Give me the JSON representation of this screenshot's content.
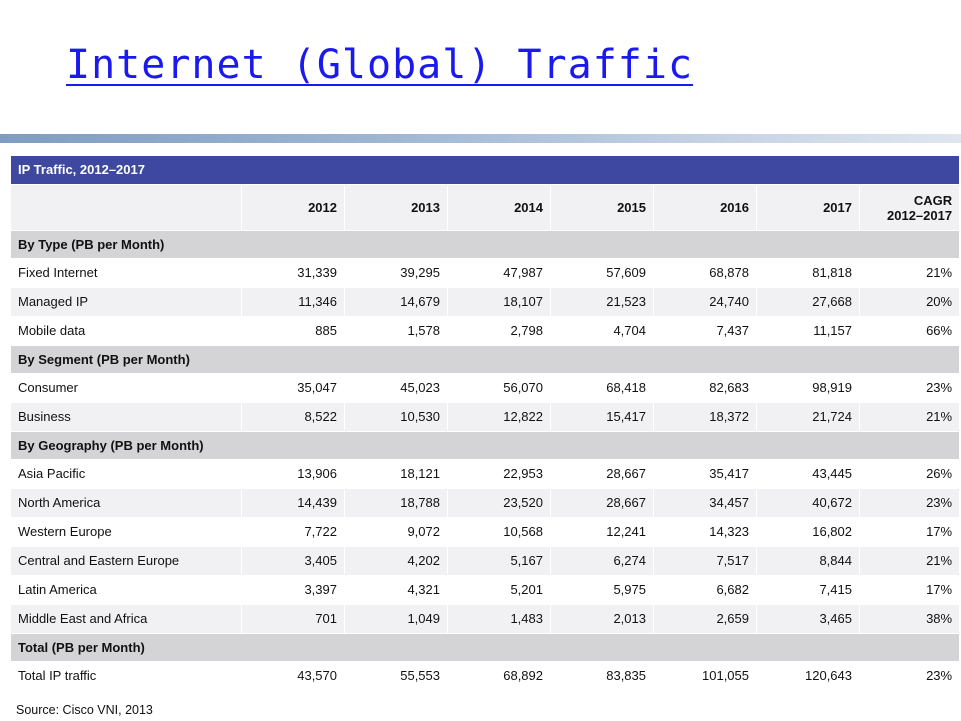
{
  "title": "Internet (Global) Traffic",
  "table": {
    "caption": "IP Traffic, 2012–2017",
    "columns": [
      "2012",
      "2013",
      "2014",
      "2015",
      "2016",
      "2017",
      "CAGR 2012–2017"
    ],
    "sections": [
      {
        "heading": "By Type (PB per Month)",
        "rows": [
          {
            "label": "Fixed Internet",
            "values": [
              "31,339",
              "39,295",
              "47,987",
              "57,609",
              "68,878",
              "81,818",
              "21%"
            ]
          },
          {
            "label": "Managed IP",
            "values": [
              "11,346",
              "14,679",
              "18,107",
              "21,523",
              "24,740",
              "27,668",
              "20%"
            ]
          },
          {
            "label": "Mobile data",
            "values": [
              "885",
              "1,578",
              "2,798",
              "4,704",
              "7,437",
              "11,157",
              "66%"
            ]
          }
        ]
      },
      {
        "heading": "By Segment (PB per Month)",
        "rows": [
          {
            "label": "Consumer",
            "values": [
              "35,047",
              "45,023",
              "56,070",
              "68,418",
              "82,683",
              "98,919",
              "23%"
            ]
          },
          {
            "label": "Business",
            "values": [
              "8,522",
              "10,530",
              "12,822",
              "15,417",
              "18,372",
              "21,724",
              "21%"
            ]
          }
        ]
      },
      {
        "heading": "By Geography (PB per Month)",
        "rows": [
          {
            "label": "Asia Pacific",
            "values": [
              "13,906",
              "18,121",
              "22,953",
              "28,667",
              "35,417",
              "43,445",
              "26%"
            ]
          },
          {
            "label": "North America",
            "values": [
              "14,439",
              "18,788",
              "23,520",
              "28,667",
              "34,457",
              "40,672",
              "23%"
            ]
          },
          {
            "label": "Western Europe",
            "values": [
              "7,722",
              "9,072",
              "10,568",
              "12,241",
              "14,323",
              "16,802",
              "17%"
            ]
          },
          {
            "label": "Central and Eastern Europe",
            "values": [
              "3,405",
              "4,202",
              "5,167",
              "6,274",
              "7,517",
              "8,844",
              "21%"
            ]
          },
          {
            "label": "Latin America",
            "values": [
              "3,397",
              "4,321",
              "5,201",
              "5,975",
              "6,682",
              "7,415",
              "17%"
            ]
          },
          {
            "label": "Middle East and Africa",
            "values": [
              "701",
              "1,049",
              "1,483",
              "2,013",
              "2,659",
              "3,465",
              "38%"
            ]
          }
        ]
      },
      {
        "heading": "Total (PB per Month)",
        "rows": [
          {
            "label": "Total IP traffic",
            "values": [
              "43,570",
              "55,553",
              "68,892",
              "83,835",
              "101,055",
              "120,643",
              "23%"
            ]
          }
        ]
      }
    ],
    "source": "Source: Cisco VNI, 2013"
  },
  "colors": {
    "title": "#1a1aee",
    "table_header": "#3e48a0",
    "section_band": "#d4d4d6",
    "row_alt": "#f1f1f4"
  }
}
